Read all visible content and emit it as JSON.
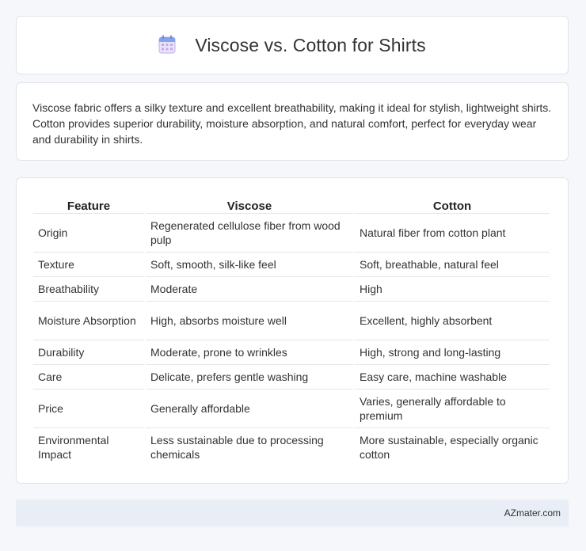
{
  "header": {
    "title": "Viscose vs. Cotton for Shirts",
    "icon": "calendar-icon"
  },
  "intro": {
    "text": "Viscose fabric offers a silky texture and excellent breathability, making it ideal for stylish, lightweight shirts. Cotton provides superior durability, moisture absorption, and natural comfort, perfect for everyday wear and durability in shirts."
  },
  "table": {
    "headers": [
      "Feature",
      "Viscose",
      "Cotton"
    ],
    "rows": [
      [
        "Origin",
        "Regenerated cellulose fiber from wood pulp",
        "Natural fiber from cotton plant"
      ],
      [
        "Texture",
        "Soft, smooth, silk-like feel",
        "Soft, breathable, natural feel"
      ],
      [
        "Breathability",
        "Moderate",
        "High"
      ],
      [
        "Moisture Absorption",
        "High, absorbs moisture well",
        "Excellent, highly absorbent"
      ],
      [
        "Durability",
        "Moderate, prone to wrinkles",
        "High, strong and long-lasting"
      ],
      [
        "Care",
        "Delicate, prefers gentle washing",
        "Easy care, machine washable"
      ],
      [
        "Price",
        "Generally affordable",
        "Varies, generally affordable to premium"
      ],
      [
        "Environmental Impact",
        "Less sustainable due to processing chemicals",
        "More sustainable, especially organic cotton"
      ]
    ]
  },
  "footer": {
    "text": "AZmater.com"
  },
  "colors": {
    "background": "#f5f7fa",
    "card": "#ffffff",
    "footer_bg": "#e9eef6",
    "icon_accent": "#8a7ee0"
  }
}
